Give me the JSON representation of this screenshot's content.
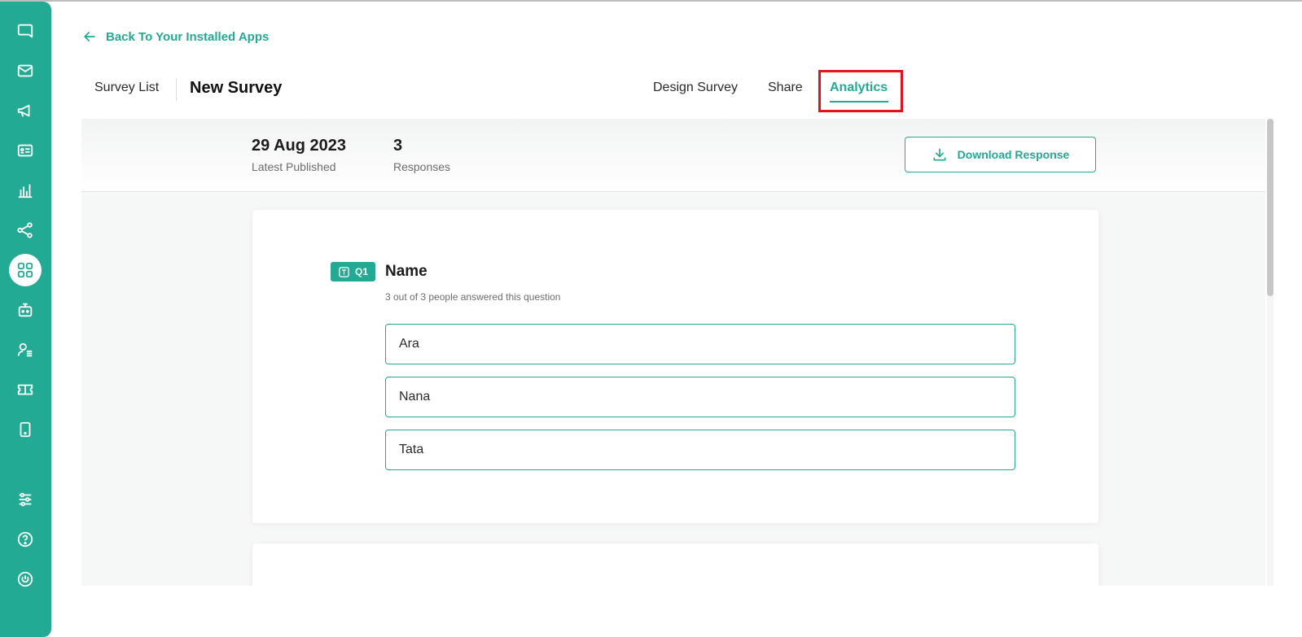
{
  "sidebar": {
    "items": [
      {
        "name": "chat-icon"
      },
      {
        "name": "mail-icon"
      },
      {
        "name": "megaphone-icon"
      },
      {
        "name": "contact-card-icon"
      },
      {
        "name": "analytics-chart-icon"
      },
      {
        "name": "share-nodes-icon"
      },
      {
        "name": "apps-grid-icon",
        "active": true
      },
      {
        "name": "bot-icon"
      },
      {
        "name": "user-list-icon"
      },
      {
        "name": "ticket-icon"
      },
      {
        "name": "mobile-icon"
      },
      {
        "name": "settings-sliders-icon"
      },
      {
        "name": "help-icon"
      },
      {
        "name": "power-icon"
      }
    ]
  },
  "back_link": {
    "label": "Back To Your Installed Apps"
  },
  "header": {
    "survey_list": "Survey List",
    "survey_title": "New Survey",
    "tabs": [
      {
        "label": "Design Survey"
      },
      {
        "label": "Share"
      },
      {
        "label": "Analytics",
        "active": true
      }
    ]
  },
  "stats": {
    "published_date": "29 Aug 2023",
    "published_label": "Latest Published",
    "responses_count": "3",
    "responses_label": "Responses",
    "download_label": "Download Response"
  },
  "question": {
    "badge": "Q1",
    "title": "Name",
    "subtitle": "3 out of 3 people answered this question",
    "answers": [
      "Ara",
      "Nana",
      "Tata"
    ]
  },
  "colors": {
    "accent": "#22aa94",
    "highlight": "#e0121b"
  }
}
